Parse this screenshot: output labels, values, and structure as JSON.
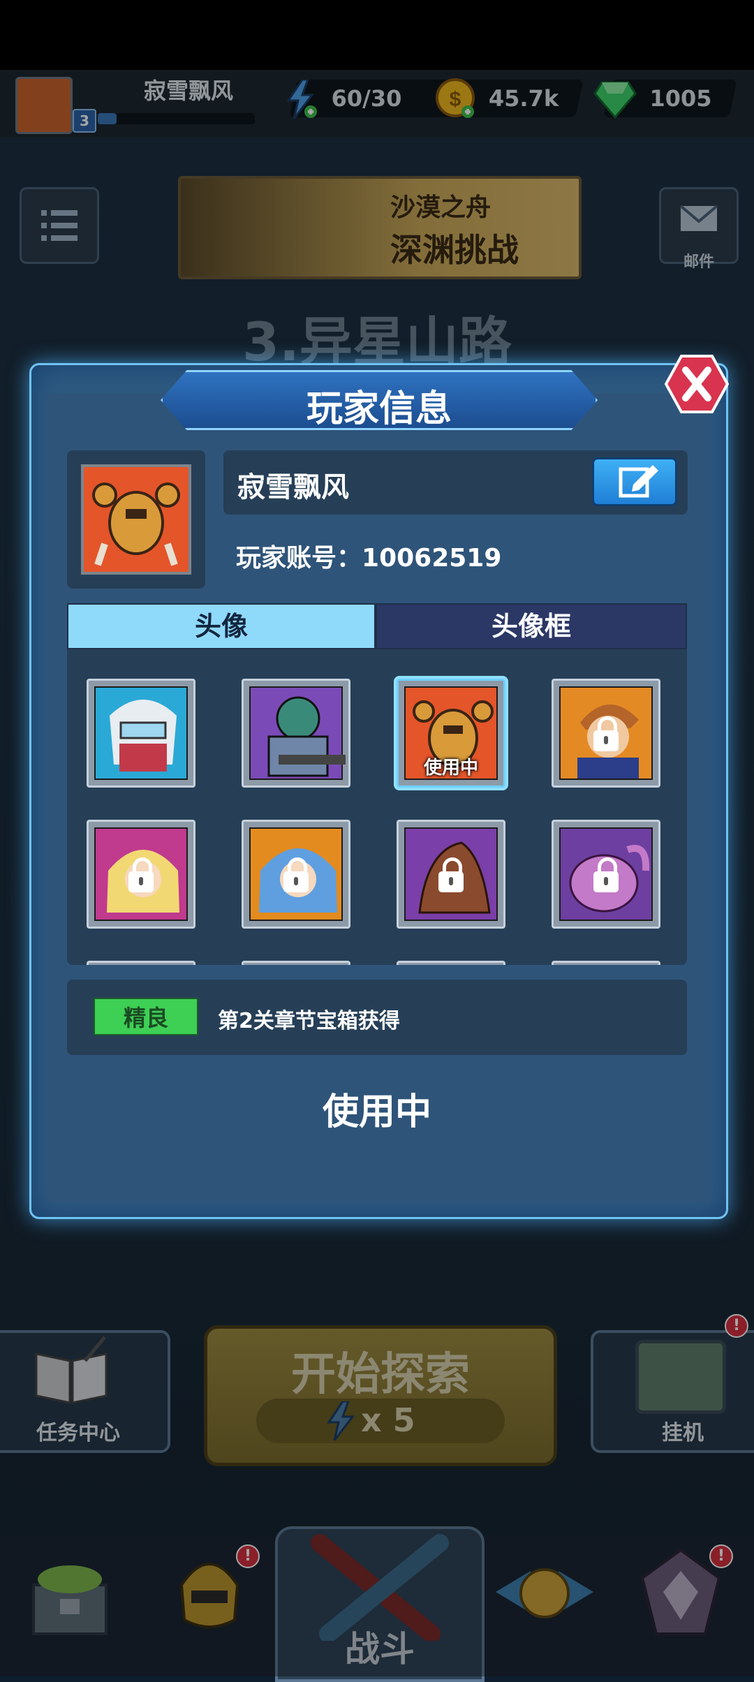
{
  "topbar": {
    "player_name": "寂雪飘风",
    "level": "3",
    "energy": "60/30",
    "gold": "45.7k",
    "gems": "1005"
  },
  "background": {
    "banner_line1": "沙漠之舟",
    "banner_line2": "深渊挑战",
    "mail_label": "邮件",
    "stage_title": "3.异星山路",
    "start_label": "开始探索",
    "cost_label": "x 5",
    "task_label": "任务中心",
    "idle_label": "挂机",
    "battle_label": "战斗"
  },
  "modal": {
    "title": "玩家信息",
    "player_name": "寂雪飘风",
    "account_label": "玩家账号：",
    "account_id": "10062519",
    "tabs": [
      {
        "label": "头像",
        "active": true
      },
      {
        "label": "头像框",
        "active": false
      }
    ],
    "avatars": [
      {
        "name": "white-hair-visor-hero",
        "bg": "#2aa9d6",
        "locked": false,
        "in_use": false
      },
      {
        "name": "armored-soldier",
        "bg": "#7a4bb7",
        "locked": false,
        "in_use": false
      },
      {
        "name": "orange-crab-mech",
        "bg": "#e4552a",
        "locked": false,
        "in_use": true
      },
      {
        "name": "blond-engineer",
        "bg": "#e48a24",
        "locked": true,
        "in_use": false
      },
      {
        "name": "blonde-girl",
        "bg": "#c03a8e",
        "locked": true,
        "in_use": false
      },
      {
        "name": "blue-hair-girl",
        "bg": "#e38b1f",
        "locked": true,
        "in_use": false
      },
      {
        "name": "brown-alien-beast",
        "bg": "#7a3fa8",
        "locked": true,
        "in_use": false
      },
      {
        "name": "purple-alien-brute",
        "bg": "#6d3fa0",
        "locked": true,
        "in_use": false
      }
    ],
    "in_use_badge": "使用中",
    "quality_badge": "精良",
    "source_text": "第2关章节宝箱获得",
    "status_button": "使用中"
  },
  "colors": {
    "tab_active": "#8fd9fb",
    "tab_inactive": "#2b3866",
    "quality_green": "#3ecf55",
    "edit_button": "#2d97e6",
    "close_button": "#d8344f",
    "start_button": "#8a7a36"
  }
}
